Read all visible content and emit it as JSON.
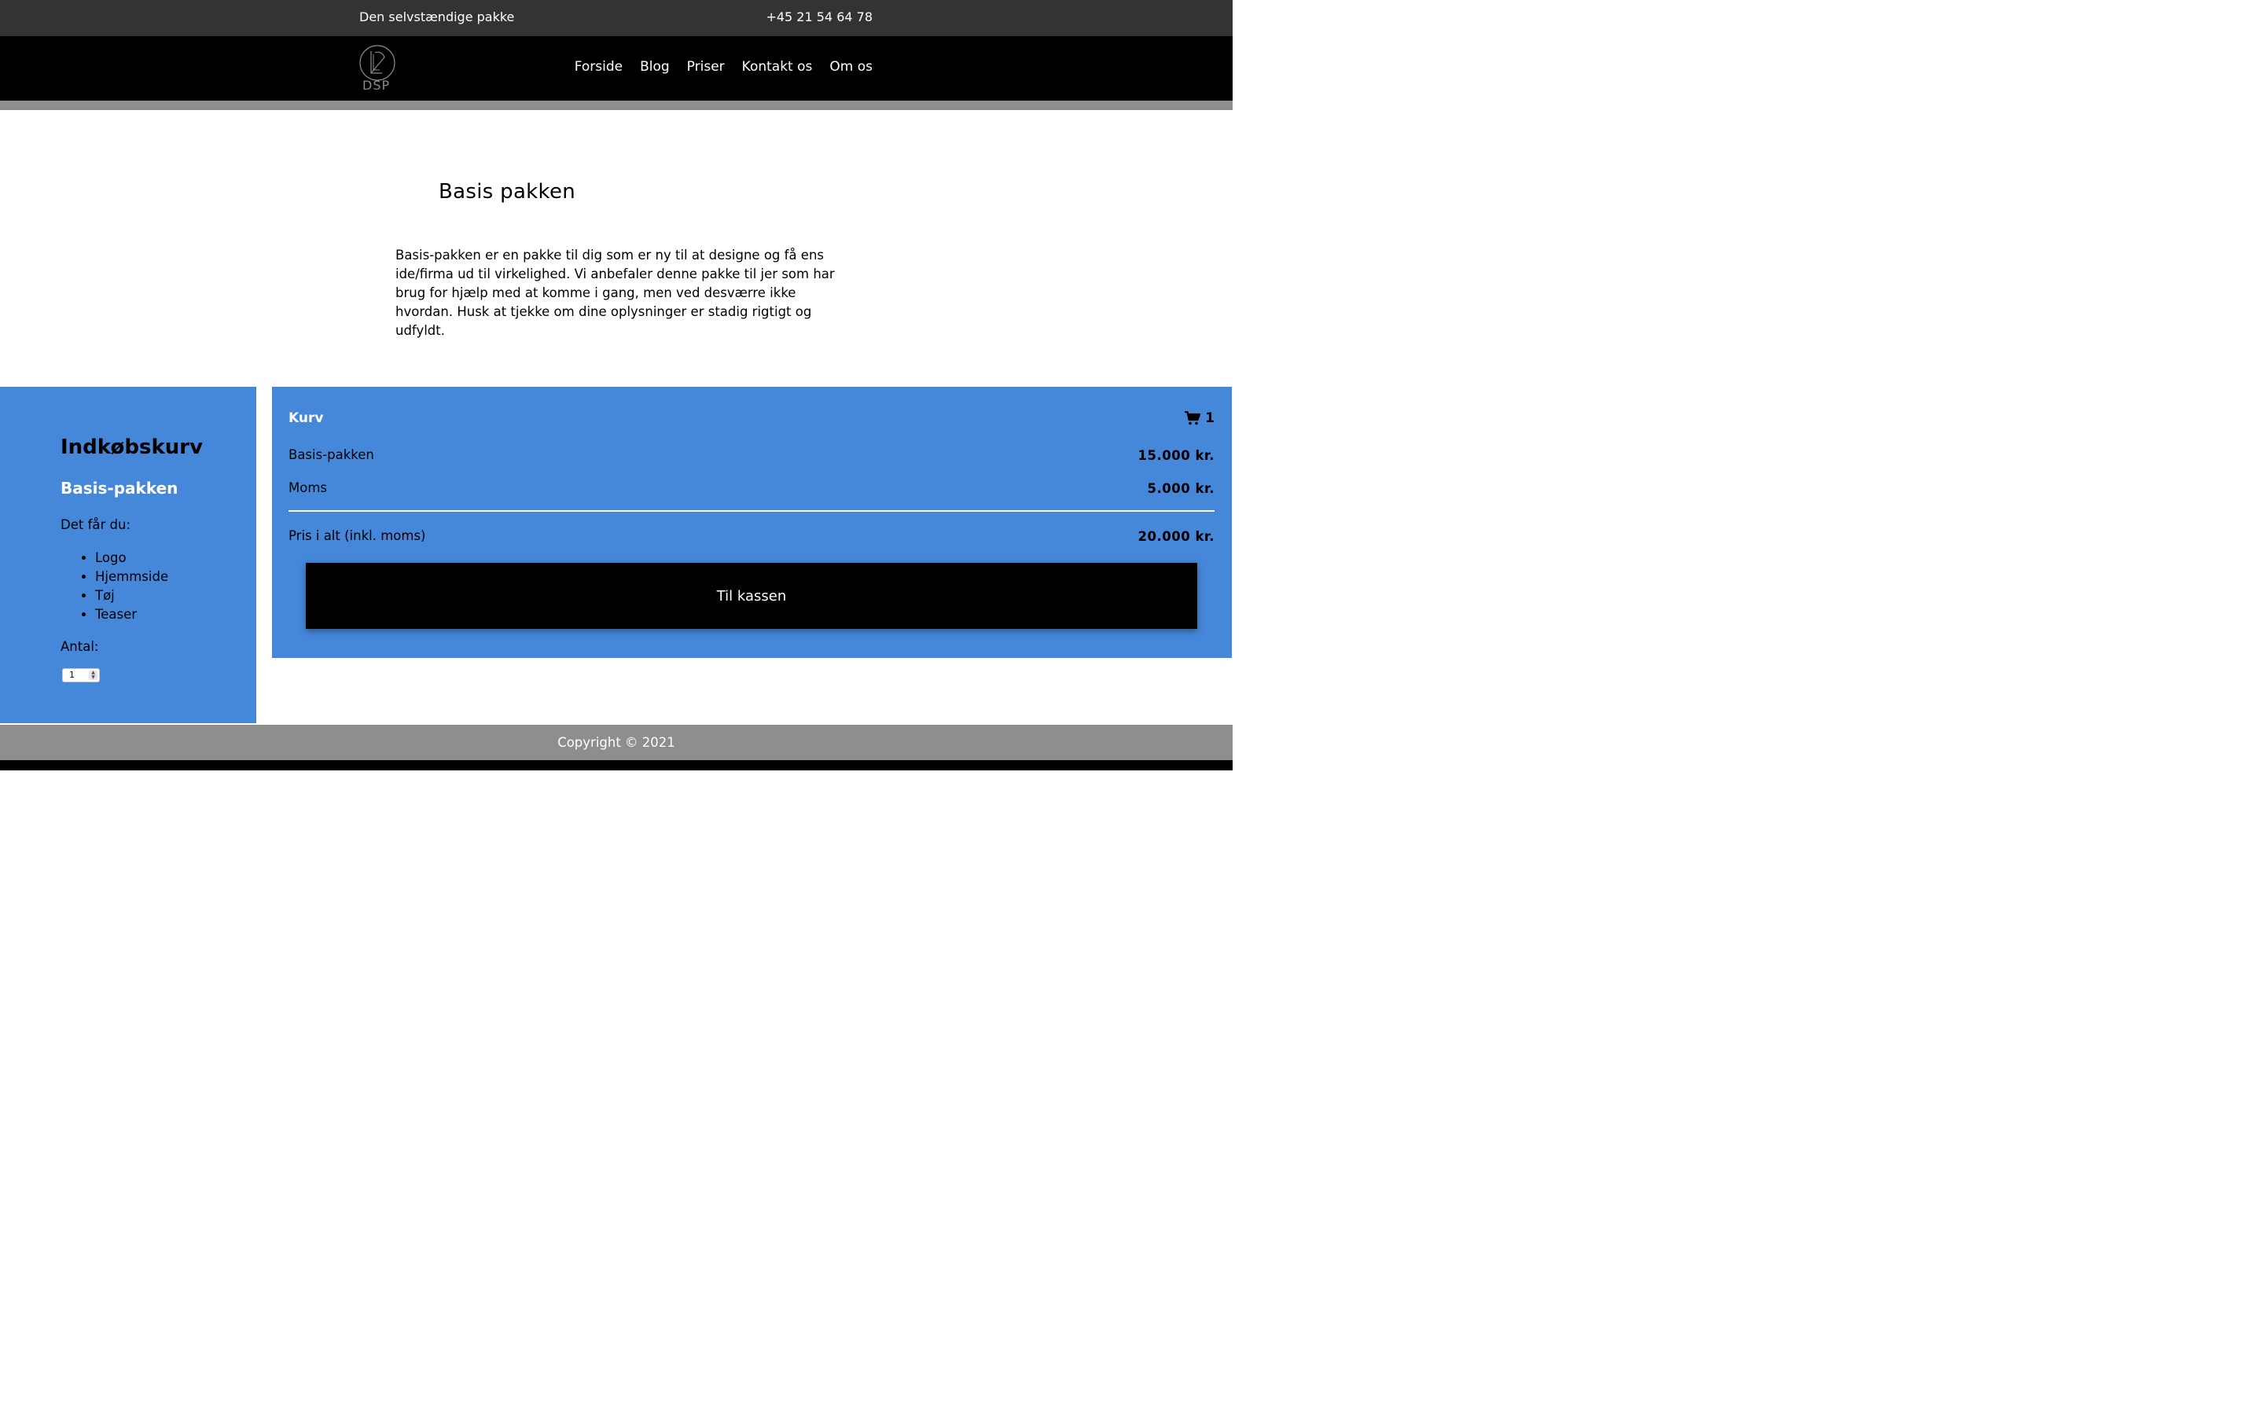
{
  "topbar": {
    "tagline": "Den selvstændige pakke",
    "phone": "+45 21 54 64 78"
  },
  "header": {
    "logo_text": "DSP"
  },
  "nav": {
    "items": [
      "Forside",
      "Blog",
      "Priser",
      "Kontakt os",
      "Om os"
    ]
  },
  "main": {
    "title": "Basis pakken",
    "description": "Basis-pakken er en pakke til dig som er ny til at designe og få ens ide/firma ud til virkelighed. Vi anbefaler denne pakke til jer som har brug for hjælp med at komme i gang, men ved desværre ikke hvordan. Husk at tjekke om dine oplysninger er stadig rigtigt og udfyldt."
  },
  "product": {
    "heading": "Indkøbskurv",
    "name": "Basis-pakken",
    "gets_label": "Det får du:",
    "features": [
      "Logo",
      "Hjemmside",
      "Tøj",
      "Teaser"
    ],
    "qty_label": "Antal:",
    "qty_value": "1"
  },
  "cart": {
    "title": "Kurv",
    "count": "1",
    "lines": [
      {
        "label": "Basis-pakken",
        "value": "15.000 kr."
      },
      {
        "label": "Moms",
        "value": "5.000 kr."
      }
    ],
    "total_label": "Pris i alt (inkl. moms)",
    "total_value": "20.000 kr.",
    "checkout_label": "Til kassen"
  },
  "footer": {
    "copyright": "Copyright © 2021"
  },
  "colors": {
    "accent": "#4587d9",
    "topbar": "#333333",
    "nav": "#000000",
    "footer": "#8e8e8e"
  }
}
